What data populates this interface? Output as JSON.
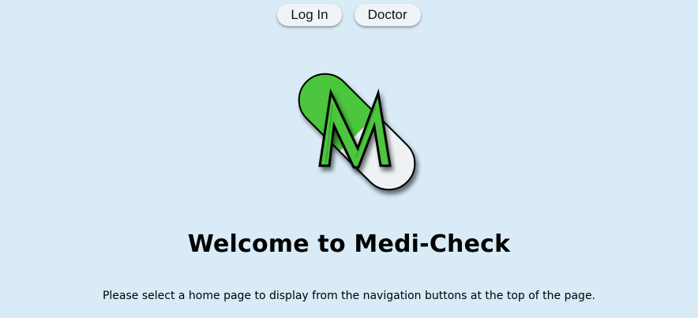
{
  "nav": {
    "login_label": "Log In",
    "doctor_label": "Doctor"
  },
  "logo": {
    "icon": "medi-check-pill-logo",
    "letter": "M",
    "colors": {
      "pill_green": "#4cc63e",
      "pill_white": "#eef2f4",
      "outline": "#000000"
    }
  },
  "main": {
    "title": "Welcome to Medi-Check",
    "subtitle": "Please select a home page to display from the navigation buttons at the top of the page."
  },
  "colors": {
    "background": "#d8ebf7",
    "button_bg": "#f0f4f7"
  }
}
